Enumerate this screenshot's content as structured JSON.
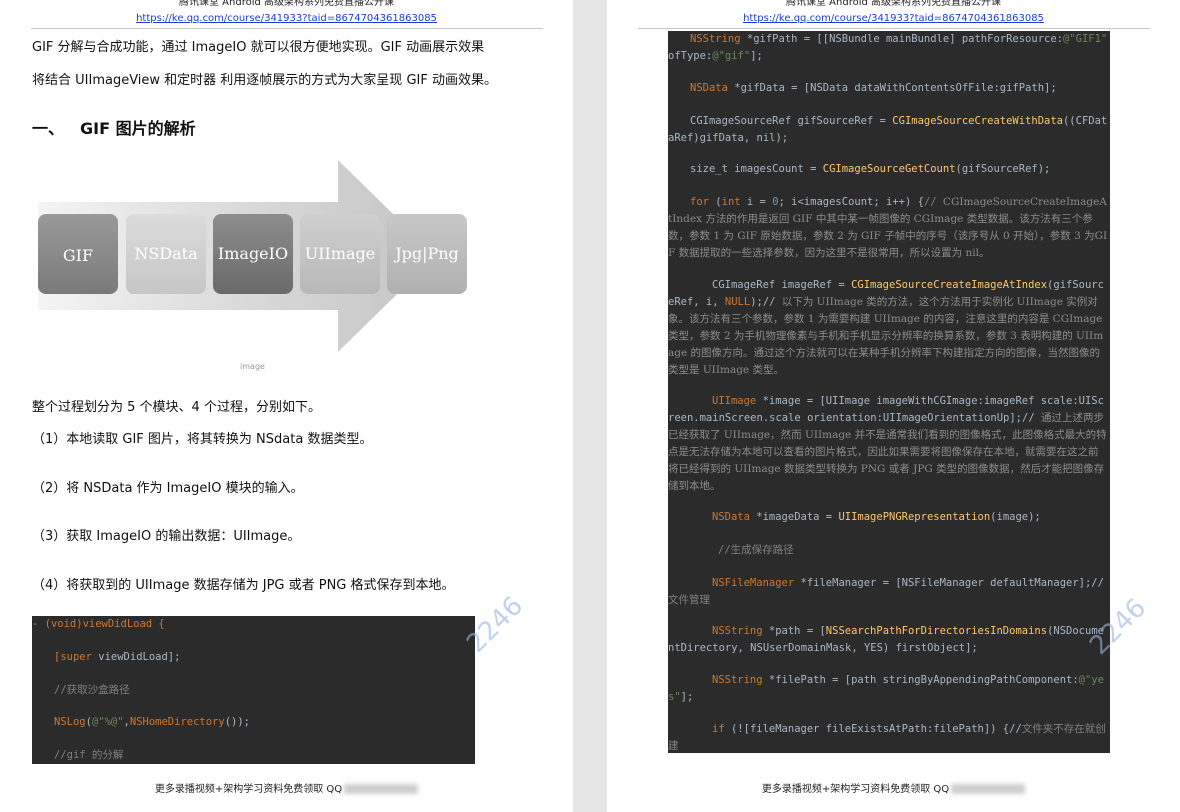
{
  "header": {
    "title": "腾讯课堂 Android 高级架构系列免费直播公开课",
    "link": "https://ke.qq.com/course/341933?taid=8674704361863085"
  },
  "left": {
    "intro_1": "GIF 分解与合成功能，通过 ImageIO 就可以很方便地实现。GIF 动画展示效果",
    "intro_2": "将结合 UIImageView 和定时器 利用逐帧展示的方式为大家呈现 GIF 动画效果。",
    "heading_num": "一、",
    "heading": "GIF 图片的解析",
    "diagram_steps": [
      "GIF",
      "NSData",
      "ImageIO",
      "UIImage",
      "Jpg|Png"
    ],
    "caption": "image",
    "summary": "整个过程划分为 5 个模块、4 个过程，分别如下。",
    "steps": [
      "（1）本地读取 GIF 图片，将其转换为 NSdata 数据类型。",
      "（2）将 NSData 作为 ImageIO 模块的输入。",
      "（3）获取 ImageIO 的输出数据：UIImage。",
      "（4）将获取到的 UIImage 数据存储为 JPG 或者 PNG 格式保存到本地。"
    ],
    "code": {
      "l1": "- (void)viewDidLoad {",
      "l2_kw": "[super",
      "l2_rest": " viewDidLoad];",
      "l3": "//获取沙盒路径",
      "l4_fn": "NSLog",
      "l4_a": "(",
      "l4_str": "@\"%@\"",
      "l4_b": ",",
      "l4_fn2": "NSHomeDirectory",
      "l4_c": "());",
      "l5": "//gif 的分解"
    },
    "footer": "更多录播视频+架构学习资料免费领取 QQ",
    "watermark": "2246"
  },
  "right": {
    "code": {
      "a1": "NSString",
      "a2": " *gifPath = [[NSBundle mainBundle] pathForResource:",
      "a3": "@\"GIF1\"",
      "a4": " ofType:",
      "a5": "@\"gif\"",
      "a6": "];",
      "b1": "NSData",
      "b2": " *gifData = [NSData dataWithContentsOfFile:gifPath];",
      "c1": "CGImageSourceRef gifSourceRef = ",
      "c2": "CGImageSourceCreateWithData",
      "c3": "((CFDataRef)gifData, nil);",
      "d1": "size_t imagesCount = ",
      "d2": "CGImageSourceGetCount",
      "d3": "(gifSourceRef);",
      "e1": "for",
      "e2": " (",
      "e3": "int",
      "e4": " i = ",
      "e5": "0",
      "e6": "; i<imagesCount; i++) {",
      "e7": "//",
      "e8": "CGImageSourceCreateImageAtIndex 方法的作用是返回 GIF 中其中某一帧图像的 CGImage 类型数据。该方法有三个参数，参数 1 为 GIF 原始数据，参数 2 为 GIF 子帧中的序号（该序号从 0 开始），参数 3 为GIF 数据提取的一些选择参数，因为这里不是很常用，所以设置为 nil。",
      "f1": "CGImageRef imageRef = ",
      "f2": "CGImageSourceCreateImageAtIndex",
      "f3": "(gifSourceRef, i, ",
      "f4": "NULL",
      "f5": ");//",
      "f6": "以下为 UIImage 类的方法，这个方法用于实例化 UIImage 实例对象。该方法有三个参数，参数 1 为需要构建 UIImage 的内容，注意这里的内容是 CGImage 类型，参数 2 为手机物理像素与手机和手机显示分辨率的换算系数，参数 3 表明构建的 UIImage 的图像方向。通过这个方法就可以在某种手机分辨率下构建指定方向的图像，当然图像的类型是 UIImage 类型。",
      "g1": "UIImage",
      "g2": " *image = [UIImage imageWithCGImage:imageRef scale:UIScreen.mainScreen.scale orientation:UIImageOrientationUp];//",
      "g3": "通过上述两步已经获取了 UIImage，然而 UIImage 并不是通常我们看到的图像格式，此图像格式最大的特点是无法存储为本地可以查看的图片格式，因此如果需要将图像保存在本地，就需要在这之前将已经得到的 UIImage 数据类型转换为 PNG 或者 JPG 类型的图像数据，然后才能把图像存储到本地。",
      "h1": "NSData",
      "h2": " *imageData = ",
      "h3": "UIImagePNGRepresentation",
      "h4": "(image);",
      "i1": "//生成保存路径",
      "j1": "NSFileManager",
      "j2": " *fileManager = [NSFileManager defaultManager];//",
      "j3": "文件管理",
      "k1": "NSString",
      "k2": " *path = [",
      "k3": "NSSearchPathForDirectoriesInDomains",
      "k4": "(NSDocumentDirectory, NSUserDomainMask, YES) firstObject];",
      "l1": "NSString",
      "l2": " *filePath = [path stringByAppendingPathComponent:",
      "l3": "@\"yes\"",
      "l4": "];",
      "m1": "if",
      "m2": " (![fileManager fileExistsAtPath:filePath]) {//",
      "m3": "文件夹不存在就创建"
    },
    "footer": "更多录播视频+架构学习资料免费领取 QQ",
    "watermark": "2246"
  },
  "colors": {
    "page": "#ffffff",
    "gutter": "#e6e6e6",
    "code_bg": "#2b2b2b",
    "link": "#1a3ed6",
    "keyword": "#cc7832",
    "string": "#6a8759",
    "function": "#ffc66d"
  }
}
